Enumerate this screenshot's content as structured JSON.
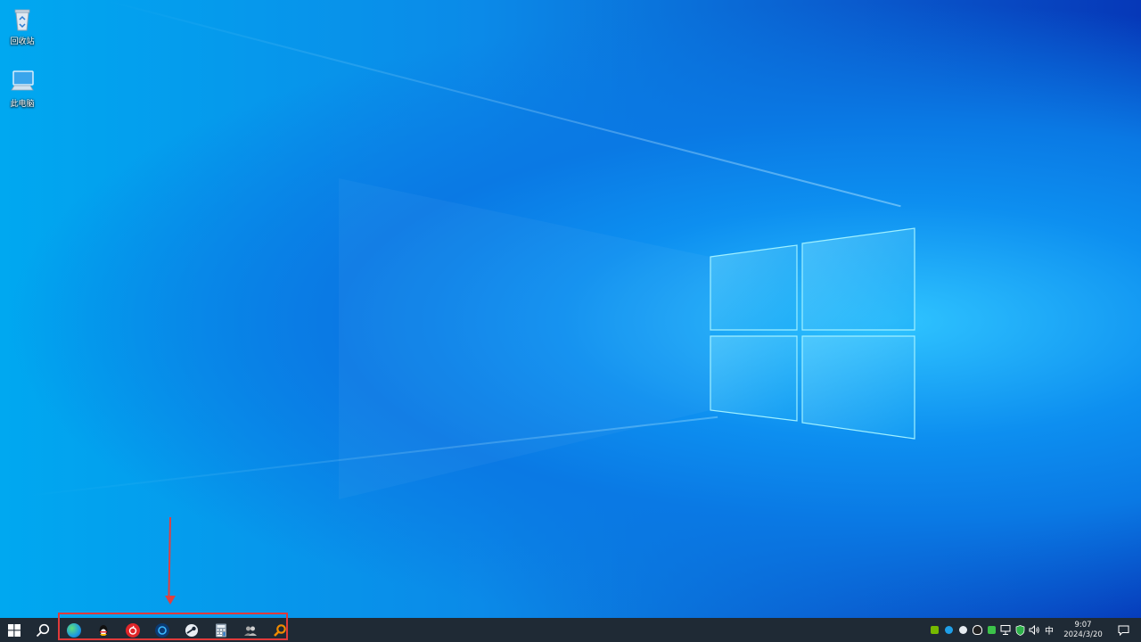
{
  "desktop": {
    "icons": [
      {
        "label": "回收站",
        "icon": "recycle-bin-icon"
      },
      {
        "label": "此电脑",
        "icon": "this-pc-icon"
      }
    ]
  },
  "taskbar": {
    "start_icon": "windows-start-icon",
    "search_icon": "search-icon",
    "pinned": [
      {
        "icon": "edge-browser-icon",
        "color": "#1e9ae0"
      },
      {
        "icon": "qq-penguin-icon",
        "color": "#111111"
      },
      {
        "icon": "netease-music-icon",
        "color": "#e0262a"
      },
      {
        "icon": "blue-circle-app-icon",
        "color": "#1b6fd6"
      },
      {
        "icon": "steam-icon",
        "color": "#1b2838"
      },
      {
        "icon": "calculator-icon",
        "color": "#6b7b8c"
      },
      {
        "icon": "people-app-icon",
        "color": "#8a8a8a"
      },
      {
        "icon": "orange-search-app-icon",
        "color": "#f08a00"
      }
    ],
    "tray": {
      "icons": [
        "nvidia-icon",
        "blue-ring-icon",
        "steam-tray-icon",
        "qq-tray-icon",
        "green-app-icon",
        "network-icon",
        "shield-icon",
        "volume-icon"
      ],
      "ime": "中",
      "time": "9:07",
      "date": "2024/3/20",
      "notification_icon": "notification-icon"
    }
  },
  "colors": {
    "taskbar": "#1f2a35",
    "highlight": "#e03a3a"
  }
}
